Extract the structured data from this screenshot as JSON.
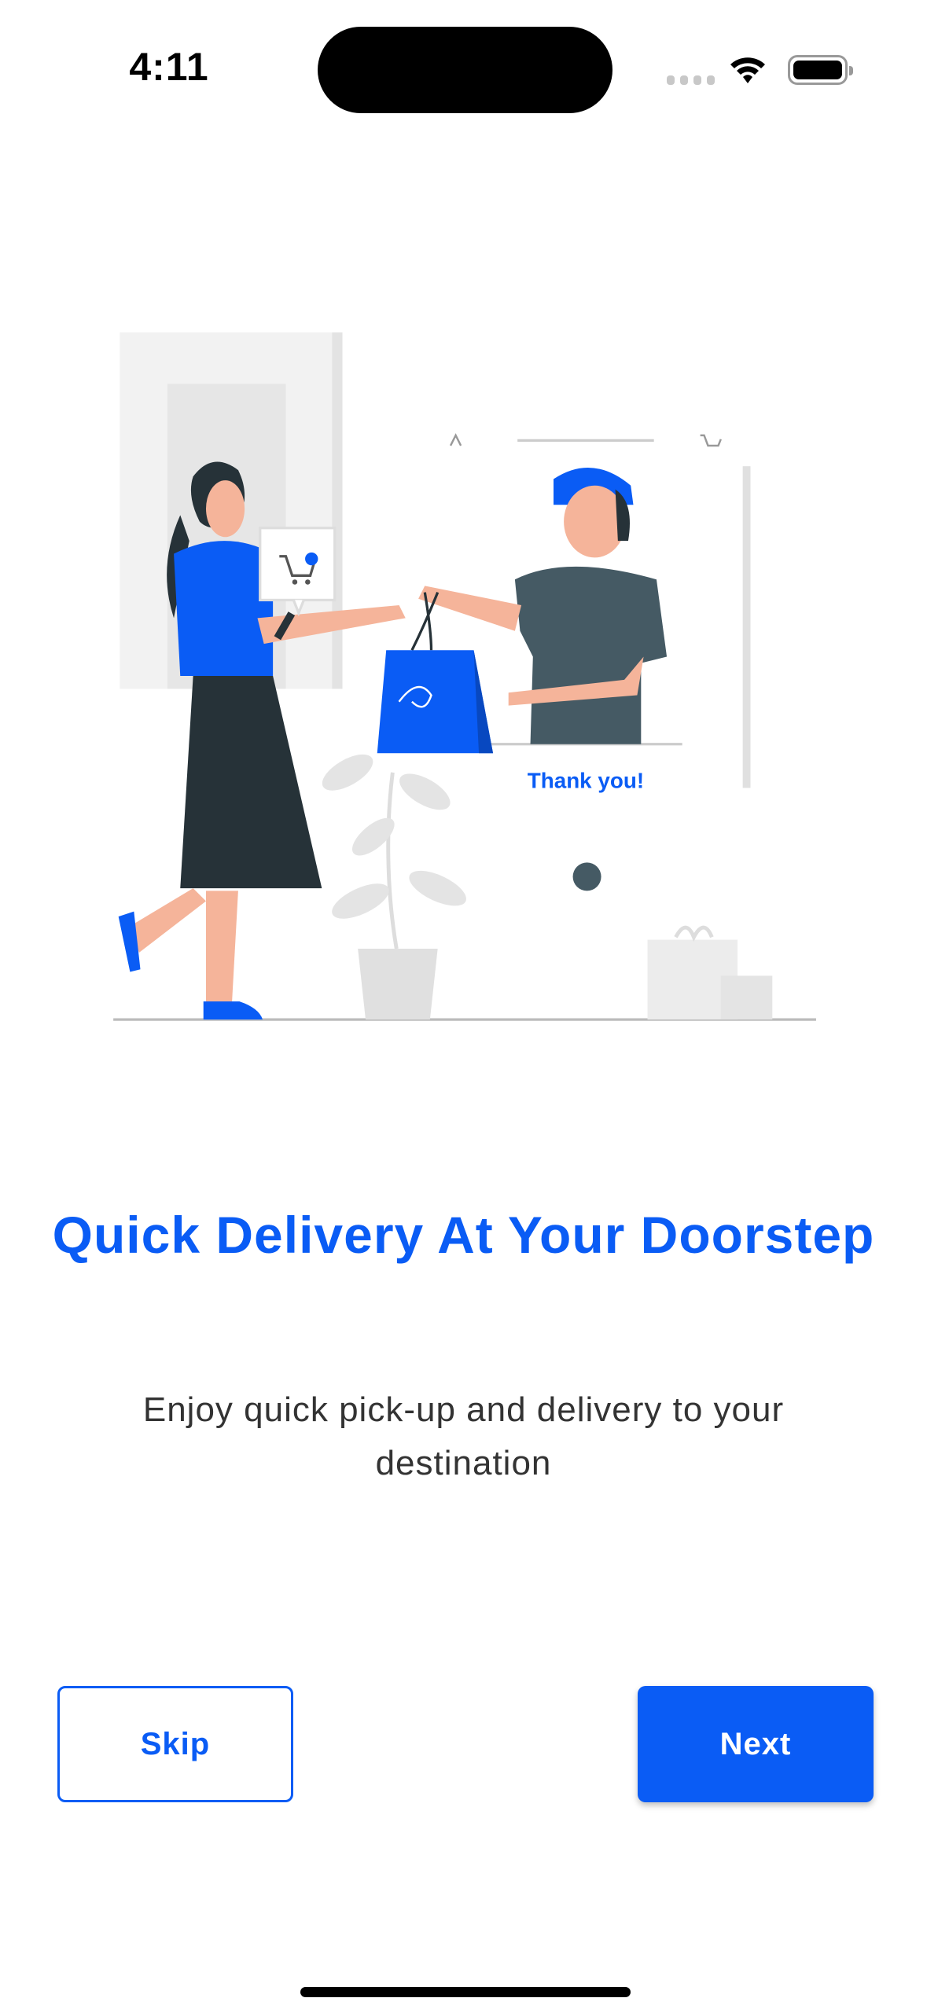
{
  "status_bar": {
    "time": "4:11"
  },
  "illustration": {
    "caption": "Thank you!"
  },
  "onboarding": {
    "title": "Quick Delivery At Your Doorstep",
    "subtitle": "Enjoy quick pick-up and delivery to your destination"
  },
  "buttons": {
    "skip": "Skip",
    "next": "Next"
  },
  "colors": {
    "accent": "#0a5cf5",
    "text": "#333333"
  }
}
